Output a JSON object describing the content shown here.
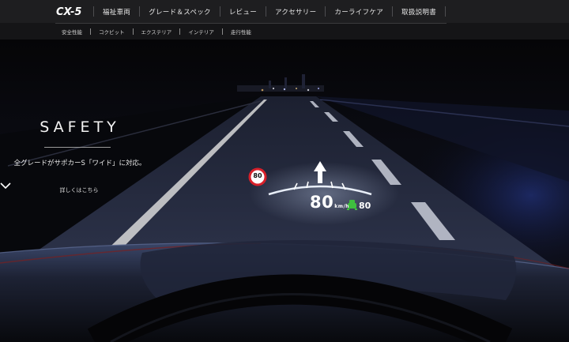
{
  "header": {
    "logo_text": "CX-5",
    "nav": [
      {
        "label": "福祉車両"
      },
      {
        "label": "グレード＆スペック"
      },
      {
        "label": "レビュー"
      },
      {
        "label": "アクセサリー"
      },
      {
        "label": "カーライフケア"
      },
      {
        "label": "取扱説明書"
      }
    ],
    "subnav": [
      {
        "label": "安全性能"
      },
      {
        "label": "コクピット"
      },
      {
        "label": "エクステリア"
      },
      {
        "label": "インテリア"
      },
      {
        "label": "走行性能"
      }
    ]
  },
  "hero": {
    "title": "SAFETY",
    "subtitle": "全グレードがサポカーS「ワイド」に対応。",
    "more_label": "詳しくはこちら",
    "hud": {
      "speed": "80",
      "unit": "km/h",
      "limit": "80",
      "sign_limit": "80"
    }
  },
  "colors": {
    "header_bg": "#1e1e20",
    "subheader_bg": "#151517",
    "hud_green": "#3fbf3f",
    "sign_red": "#d8202a"
  }
}
